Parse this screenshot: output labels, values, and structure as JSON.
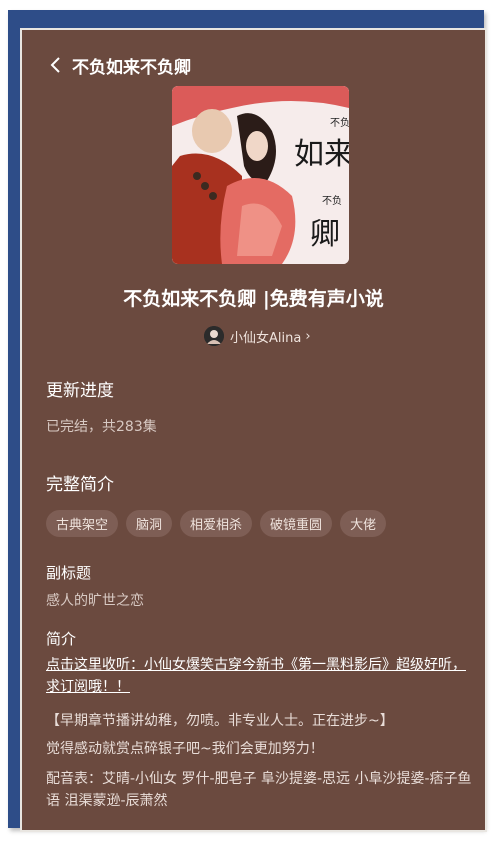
{
  "header": {
    "title": "不负如来不负卿"
  },
  "cover": {
    "text_top": "不负",
    "text_main": "如来",
    "text_bottom_small": "不负",
    "text_last": "卿"
  },
  "main_title": "不负如来不负卿 |免费有声小说",
  "author": {
    "name": "小仙女Alina",
    "chevron": "›"
  },
  "progress": {
    "heading": "更新进度",
    "status": "已完结，共283集"
  },
  "intro": {
    "heading": "完整简介",
    "tags": [
      "古典架空",
      "脑洞",
      "相爱相杀",
      "破镜重圆",
      "大佬"
    ]
  },
  "subtitle": {
    "heading": "副标题",
    "text": "感人的旷世之恋"
  },
  "summary": {
    "heading": "简介",
    "link": "点击这里收听：小仙女爆笑古穿今新书《第一黑料影后》超级好听，求订阅哦！！",
    "p1": "【早期章节播讲幼稚，勿喷。非专业人士。正在进步~】",
    "p2": "觉得感动就赏点碎银子吧~我们会更加努力！",
    "p3": "配音表：艾晴-小仙女 罗什-肥皂子 阜沙提婆-思远 小阜沙提婆-痞子鱼语 沮渠蒙逊-辰萧然"
  },
  "colors": {
    "frame": "#2e4d88",
    "panel": "#6b4a3f",
    "tag_bg": "#7e5e55"
  },
  "icons": {
    "back": "chevron-left-icon"
  }
}
